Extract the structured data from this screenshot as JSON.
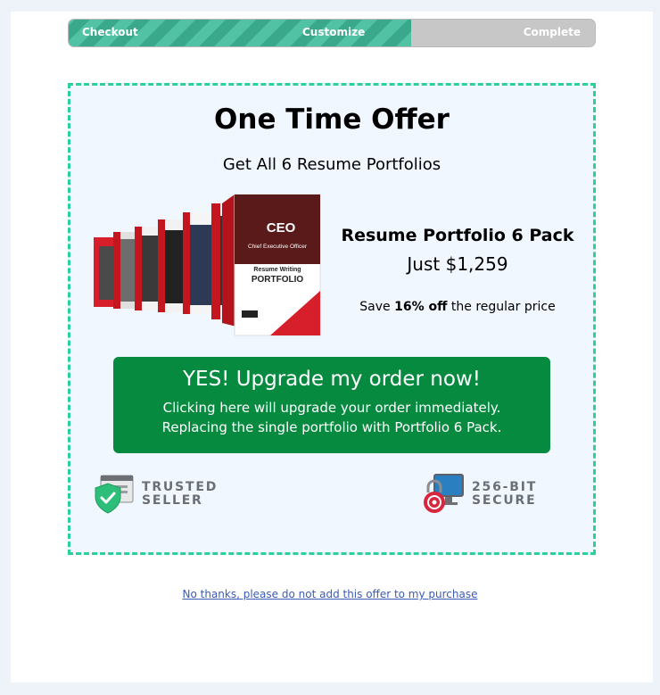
{
  "progress": {
    "steps": [
      "Checkout",
      "Customize",
      "Complete"
    ],
    "completed_fraction": 0.65,
    "colors": {
      "done": "#52c2a5",
      "pending": "#c7c7c7"
    }
  },
  "offer": {
    "title": "One Time Offer",
    "subtitle": "Get All 6 Resume Portfolios",
    "product": {
      "box_label_ceo": "CEO",
      "box_label_role": "Chief Executive Officer",
      "box_label_line1": "Resume Writing",
      "box_label_line2": "PORTFOLIO",
      "box_icon": "resume-portfolio-boxes-image"
    },
    "pack_name": "Resume Portfolio 6 Pack",
    "pack_price": "Just $1,259",
    "save_prefix": "Save ",
    "save_amount": "16% off",
    "save_suffix": " the regular price",
    "cta": {
      "main": "YES! Upgrade my order now!",
      "sub_line1": "Clicking here will upgrade your order immediately.",
      "sub_line2": "Replacing the single portfolio with Portfolio 6 Pack.",
      "color": "#068a3f"
    },
    "badges": {
      "trusted_line1": "TRUSTED",
      "trusted_line2": "SELLER",
      "trusted_icon": "shield-check-icon",
      "secure_line1": "256-BIT",
      "secure_line2": "SECURE",
      "secure_icon": "lock-monitor-icon"
    },
    "border_color": "#2bd09a"
  },
  "decline_link": "No thanks, please do not add this offer to my purchase"
}
